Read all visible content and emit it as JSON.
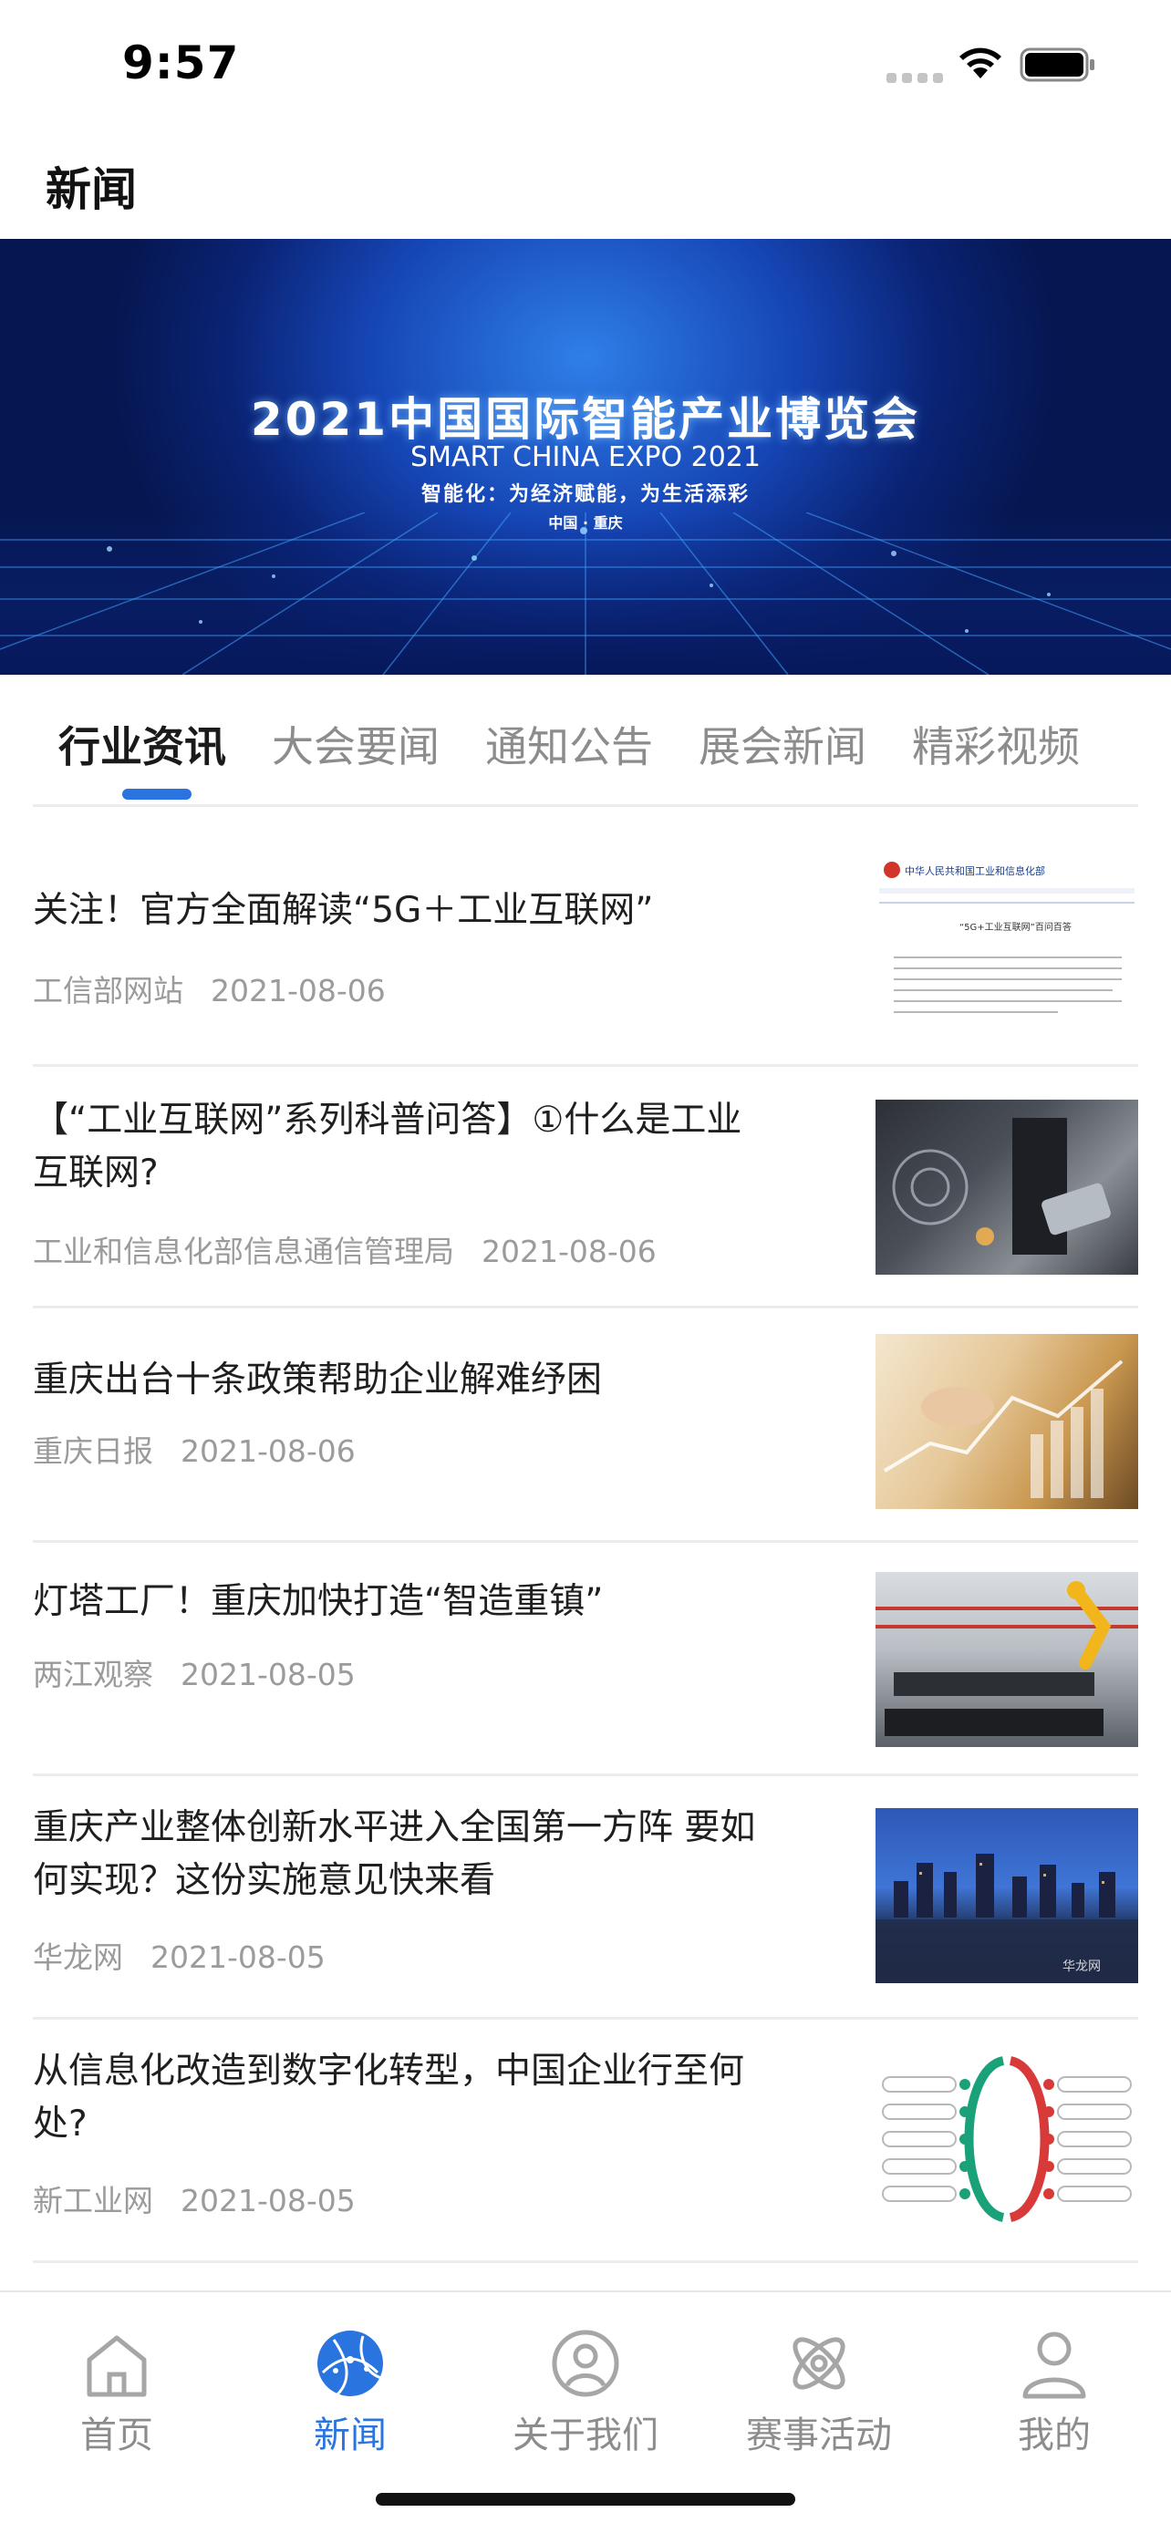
{
  "status_bar": {
    "time": "9:57"
  },
  "header": {
    "title": "新闻"
  },
  "banner": {
    "title": "2021中国国际智能产业博览会",
    "subtitle": "SMART CHINA EXPO 2021",
    "slogan": "智能化：为经济赋能，为生活添彩",
    "location": "中国 · 重庆"
  },
  "tabs": [
    {
      "label": "行业资讯",
      "active": true
    },
    {
      "label": "大会要闻",
      "active": false
    },
    {
      "label": "通知公告",
      "active": false
    },
    {
      "label": "展会新闻",
      "active": false
    },
    {
      "label": "精彩视频",
      "active": false
    }
  ],
  "news": [
    {
      "title": "关注！官方全面解读“5G＋工业互联网”",
      "source": "工信部网站",
      "date": "2021-08-06",
      "thumb": "document-screenshot",
      "thumb_texts": [
        "中华人民共和国工业和信息化部",
        "“5G+工业互联网”百问百答"
      ]
    },
    {
      "title": "【“工业互联网”系列科普问答】①什么是工业互联网?",
      "source": "工业和信息化部信息通信管理局",
      "date": "2021-08-06",
      "thumb": "industrial-tech-photo"
    },
    {
      "title": "重庆出台十条政策帮助企业解难纾困",
      "source": "重庆日报",
      "date": "2021-08-06",
      "thumb": "business-chart-photo"
    },
    {
      "title": "灯塔工厂！重庆加快打造“智造重镇”",
      "source": "两江观察",
      "date": "2021-08-05",
      "thumb": "factory-robot-photo"
    },
    {
      "title": "重庆产业整体创新水平进入全国第一方阵 要如何实现？这份实施意见快来看",
      "source": "华龙网",
      "date": "2021-08-05",
      "thumb": "city-night-photo",
      "thumb_texts": [
        "华龙网"
      ]
    },
    {
      "title": "从信息化改造到数字化转型，中国企业行至何处?",
      "source": "新工业网",
      "date": "2021-08-05",
      "thumb": "mindmap-diagram"
    }
  ],
  "tabbar": [
    {
      "label": "首页",
      "icon": "home-icon",
      "active": false
    },
    {
      "label": "新闻",
      "icon": "globe-news-icon",
      "active": true
    },
    {
      "label": "关于我们",
      "icon": "user-circle-icon",
      "active": false
    },
    {
      "label": "赛事活动",
      "icon": "atom-icon",
      "active": false
    },
    {
      "label": "我的",
      "icon": "person-icon",
      "active": false
    }
  ],
  "colors": {
    "accent": "#2a74e0",
    "text_primary": "#1f1f1f",
    "text_secondary": "#9b9b9b",
    "divider": "#ececec"
  }
}
